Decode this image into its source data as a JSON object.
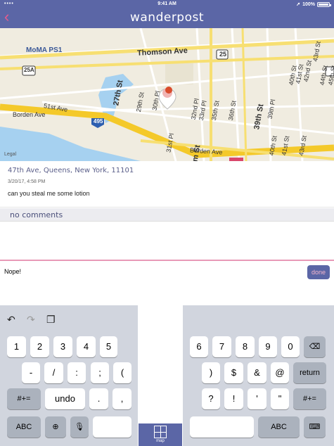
{
  "status": {
    "signal": "•••• ",
    "time": "9:41 AM",
    "battery": "100%"
  },
  "nav": {
    "back": "‹",
    "title": "wanderpost"
  },
  "map": {
    "labels": {
      "moma": "MoMA PS1",
      "thomson": "Thomson Ave",
      "route25": "25",
      "route25a": "25A",
      "ave51": "51st Ave",
      "borden1": "Borden Ave",
      "borden2": "Borden Ave",
      "i495": "495",
      "st27": "27th St",
      "st29": "29th St",
      "st30": "30th Pl",
      "st31": "31st Pl",
      "st32": "32nd Pl",
      "st33": "33rd Pl",
      "st35": "35th St",
      "st36": "36th St",
      "st39": "39th St",
      "st39pl": "39th Pl",
      "st40": "40th St",
      "st41": "41st St",
      "st42": "42nd St",
      "st43": "43rd St",
      "st44": "44th St",
      "st45": "45th St",
      "st40b": "40th St",
      "st41b": "41st St",
      "st43b": "43rd St",
      "van": "Van Dam St",
      "legal": "Legal"
    }
  },
  "post": {
    "address": "47th Ave, Queens, New York, 11101",
    "datetime": "3/20/17, 4:58 PM",
    "message": "can you steal me some lotion"
  },
  "comments": {
    "label": "no comments"
  },
  "composer": {
    "value": "Nope!",
    "done": "done"
  },
  "keyboard": {
    "left": {
      "row1": [
        "1",
        "2",
        "3",
        "4",
        "5"
      ],
      "row2": [
        "-",
        "/",
        ":",
        ";",
        "("
      ],
      "row3_symbols": "#+=",
      "row3": [
        "undo",
        ".",
        ","
      ],
      "abc": "ABC"
    },
    "right": {
      "row1": [
        "6",
        "7",
        "8",
        "9",
        "0"
      ],
      "row2": [
        ")",
        "$",
        "&",
        "@"
      ],
      "return": "return",
      "row3": [
        "?",
        "!",
        "'",
        "\""
      ],
      "row3_symbols": "#+=",
      "abc": "ABC"
    },
    "map_button": "map"
  }
}
